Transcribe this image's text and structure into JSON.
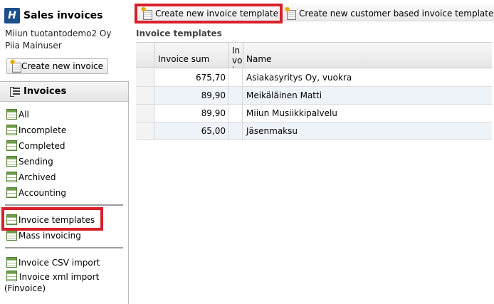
{
  "app": {
    "title": "Sales invoices",
    "logo_letter": "H",
    "company": "Miiun tuotantodemo2 Oy",
    "user": "Piia Mainuser"
  },
  "sidebar": {
    "create_button_label": "Create new invoice",
    "nav_header": "Invoices",
    "items": [
      {
        "label": "All"
      },
      {
        "label": "Incomplete"
      },
      {
        "label": "Completed"
      },
      {
        "label": "Sending"
      },
      {
        "label": "Archived"
      },
      {
        "label": "Accounting"
      },
      {
        "label": "Invoice templates"
      },
      {
        "label": "Mass invoicing"
      },
      {
        "label": "Invoice CSV import"
      },
      {
        "label": "Invoice xml import (Finvoice)"
      }
    ],
    "selected_item": "Invoice templates"
  },
  "toolbar": {
    "create_template_label": "Create new invoice template",
    "create_customer_template_label": "Create new customer based invoice template"
  },
  "main": {
    "section_title": "Invoice templates",
    "columns": [
      "Invoice sum",
      "Invoice type",
      "Name"
    ],
    "rows": [
      {
        "sum": "675,70",
        "type": "",
        "name": "Asiakasyritys Oy, vuokra"
      },
      {
        "sum": "89,90",
        "type": "",
        "name": "Meikäläinen Matti"
      },
      {
        "sum": "89,90",
        "type": "",
        "name": "Miiun Musiikkipalvelu"
      },
      {
        "sum": "65,00",
        "type": "",
        "name": "Jäsenmaksu"
      }
    ]
  },
  "colors": {
    "highlight": "#d8202b",
    "brand": "#1b4f8a",
    "row_alt": "#eef3f9"
  }
}
